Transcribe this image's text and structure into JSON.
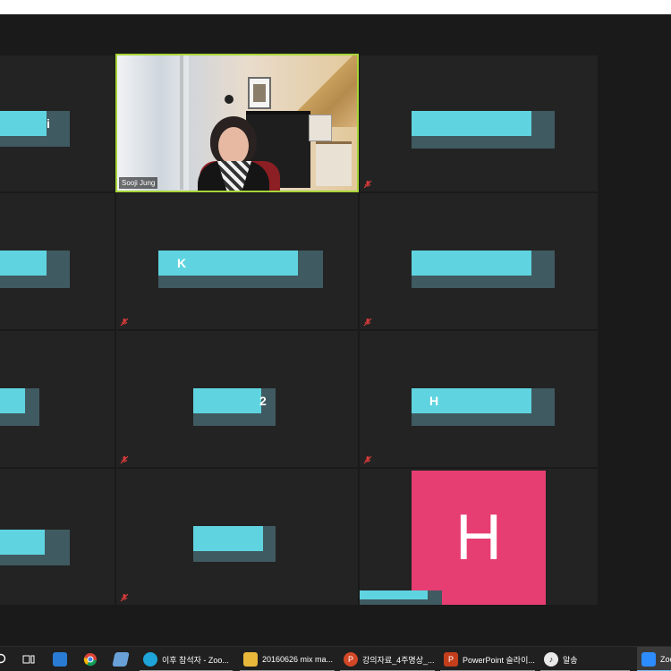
{
  "meeting": {
    "active_speaker": "Sooji Jung",
    "avatar_initial": "H",
    "bar_chars": {
      "r0c0": "i",
      "r1c1": "K",
      "r2c1": "2",
      "r2c2": "H"
    }
  },
  "taskbar": {
    "items": [
      {
        "label": "",
        "icon": "search-icon"
      },
      {
        "label": "",
        "icon": "task-view-icon"
      },
      {
        "label": "",
        "icon": "file-explorer-icon"
      },
      {
        "label": "",
        "icon": "chrome-icon"
      },
      {
        "label": "",
        "icon": "app-icon"
      },
      {
        "label": "이후 참석자 - Zoo...",
        "icon": "edge-icon"
      },
      {
        "label": "20160626 mix ma...",
        "icon": "folder-icon"
      },
      {
        "label": "강의자료_4주명상_...",
        "icon": "powerpoint-icon"
      },
      {
        "label": "PowerPoint 슬라이...",
        "icon": "powerpoint-slides-icon"
      },
      {
        "label": "알송",
        "icon": "alsong-icon"
      },
      {
        "label": "Zoo",
        "icon": "zoom-icon"
      }
    ]
  },
  "colors": {
    "active_border": "#a8d63a",
    "avatar_bg": "#e63e72",
    "redaction": "#5fd4e0"
  }
}
